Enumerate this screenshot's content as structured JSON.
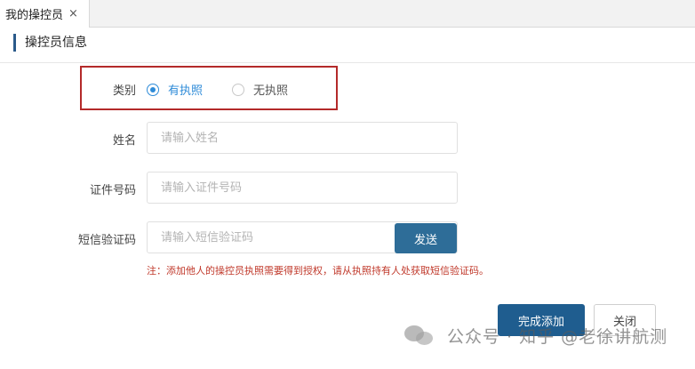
{
  "tab": {
    "title": "我的操控员",
    "close_glyph": "×"
  },
  "section": {
    "title": "操控员信息"
  },
  "form": {
    "category": {
      "label": "类别",
      "options": [
        {
          "label": "有执照",
          "checked": true
        },
        {
          "label": "无执照",
          "checked": false
        }
      ]
    },
    "name": {
      "label": "姓名",
      "placeholder": "请输入姓名",
      "value": ""
    },
    "id_number": {
      "label": "证件号码",
      "placeholder": "请输入证件号码",
      "value": ""
    },
    "sms_code": {
      "label": "短信验证码",
      "placeholder": "请输入短信验证码",
      "value": "",
      "send_label": "发送"
    },
    "note": "注：添加他人的操控员执照需要得到授权，请从执照持有人处获取短信验证码。"
  },
  "actions": {
    "submit_label": "完成添加",
    "close_label": "关闭"
  },
  "watermark": {
    "text": "公众号 · 知乎 @老徐讲航测"
  },
  "colors": {
    "accent": "#2e8bd8",
    "primary": "#1f5d8f",
    "send": "#2e6d98",
    "warning": "#c0392b",
    "highlight": "#b42a2a"
  }
}
